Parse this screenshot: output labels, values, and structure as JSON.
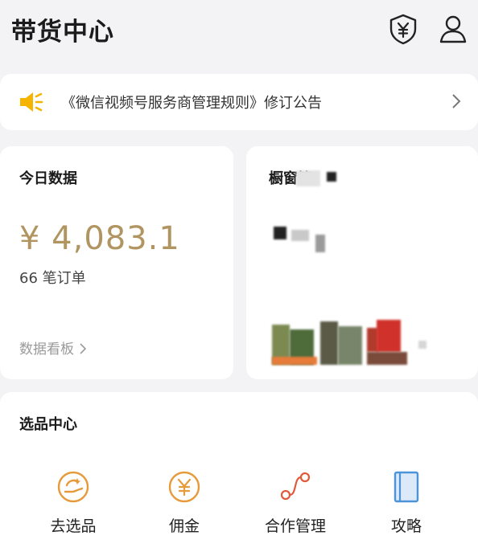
{
  "header": {
    "title": "带货中心"
  },
  "notice": {
    "text": "《微信视频号服务商管理规则》修订公告"
  },
  "today": {
    "title": "今日数据",
    "amount": "¥ 4,083.1",
    "orders": "66 笔订单",
    "board_link": "数据看板"
  },
  "window": {
    "title": "橱窗管"
  },
  "select": {
    "title": "选品中心",
    "tools": [
      {
        "label": "去选品",
        "icon": "select-product-icon"
      },
      {
        "label": "佣金",
        "icon": "yen-coin-icon"
      },
      {
        "label": "合作管理",
        "icon": "cooperation-icon"
      },
      {
        "label": "攻略",
        "icon": "book-icon"
      }
    ]
  },
  "colors": {
    "accent_gold": "#b19561",
    "speaker_yellow": "#f5b400",
    "icon_orange": "#e79a3a",
    "icon_red": "#e05a3a",
    "icon_blue": "#4c93d8"
  }
}
